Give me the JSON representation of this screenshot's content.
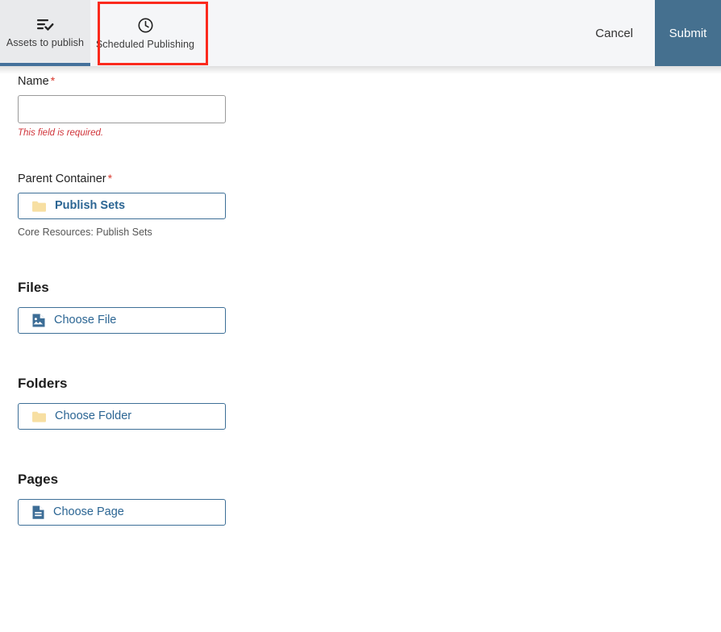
{
  "toolbar": {
    "tabs": [
      {
        "label": "Assets to publish",
        "icon": "list-check-icon",
        "active": true
      },
      {
        "label": "Scheduled Publishing",
        "icon": "clock-icon",
        "active": false
      }
    ],
    "cancel_label": "Cancel",
    "submit_label": "Submit",
    "submit_color": "#45708f",
    "active_tab_underline_color": "#44719b",
    "highlight_color": "#fb2a1d"
  },
  "form": {
    "name_field": {
      "label": "Name",
      "required_marker": "*",
      "value": "",
      "placeholder": "",
      "error": "This field is required."
    },
    "parent_container_field": {
      "label": "Parent Container",
      "required_marker": "*",
      "value": "Publish Sets",
      "icon": "folder-icon",
      "helper": "Core Resources: Publish Sets"
    },
    "sections": [
      {
        "title": "Files",
        "button_label": "Choose File",
        "button_icon": "image-file-icon"
      },
      {
        "title": "Folders",
        "button_label": "Choose Folder",
        "button_icon": "folder-icon"
      },
      {
        "title": "Pages",
        "button_label": "Choose Page",
        "button_icon": "page-icon"
      }
    ]
  }
}
